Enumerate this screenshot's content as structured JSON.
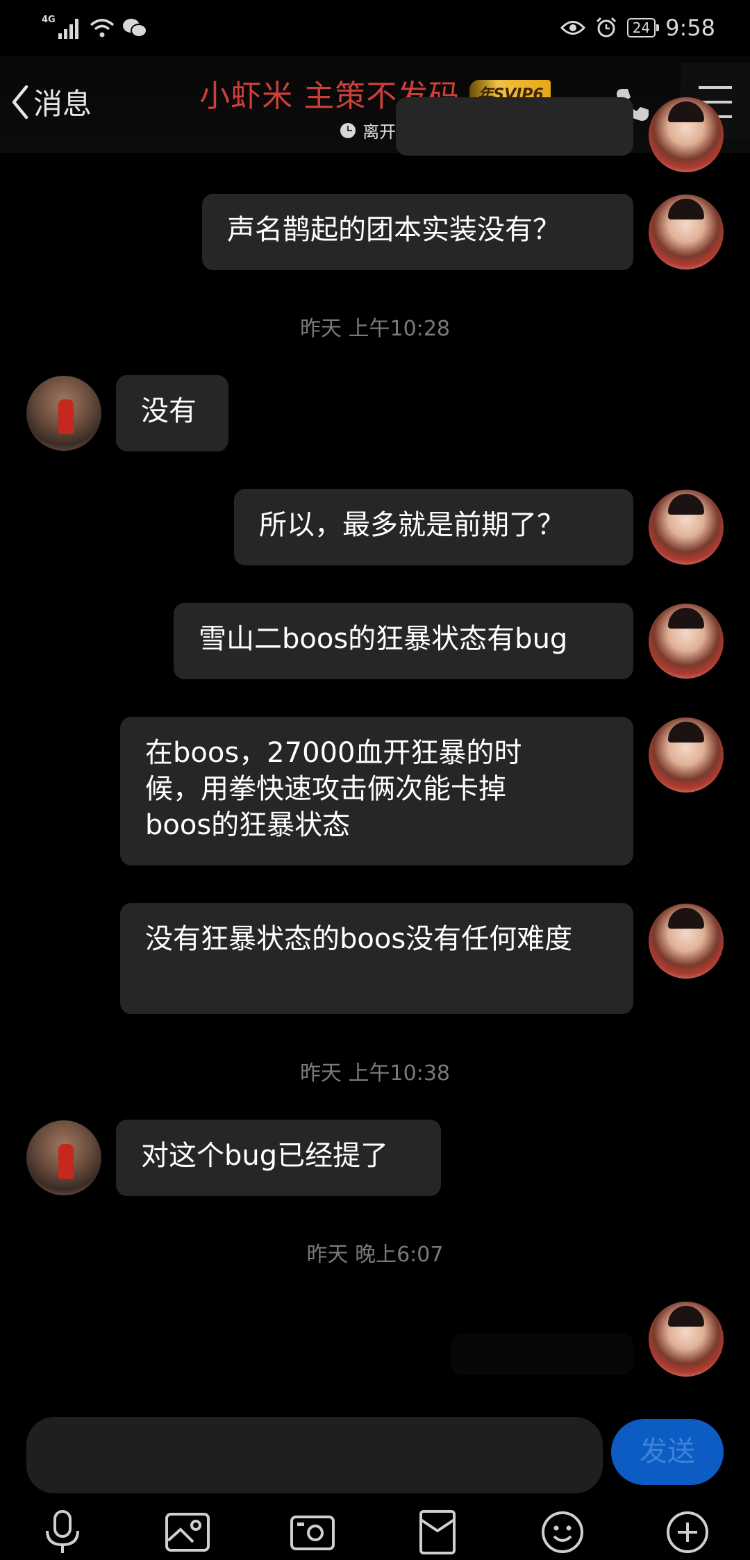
{
  "status_bar": {
    "network": "4G",
    "battery": "24",
    "time": "9:58"
  },
  "header": {
    "back_label": "消息",
    "title": "小虾米 主策不发码",
    "badge": "年SVIP6",
    "presence": "离开",
    "presence_arrow": "›"
  },
  "messages": [
    {
      "side": "right",
      "text": "声名鹊起的团本实装没有？"
    },
    {
      "type": "timestamp",
      "text": "昨天 上午10:28"
    },
    {
      "side": "left",
      "text": "没有"
    },
    {
      "side": "right",
      "text": "所以，最多就是前期了？"
    },
    {
      "side": "right",
      "text": "雪山二boos的狂暴状态有bug"
    },
    {
      "side": "right",
      "text": "在boos，27000血开狂暴的时候，用拳快速攻击俩次能卡掉boos的狂暴状态"
    },
    {
      "side": "right",
      "text": "没有狂暴状态的boos没有任何难度"
    },
    {
      "type": "timestamp",
      "text": "昨天 上午10:38"
    },
    {
      "side": "left",
      "text": "对这个bug已经提了"
    },
    {
      "type": "timestamp",
      "text": "昨天 晚上6:07"
    }
  ],
  "input": {
    "placeholder": "",
    "send_label": "发送"
  },
  "toolbar": [
    "microphone-icon",
    "image-icon",
    "camera-icon",
    "red-packet-icon",
    "emoji-icon",
    "plus-icon"
  ],
  "colors": {
    "title": "#cf3f3a",
    "bubble": "#262626",
    "send": "#0c5cc4",
    "timestamp": "#7a7a7a"
  }
}
